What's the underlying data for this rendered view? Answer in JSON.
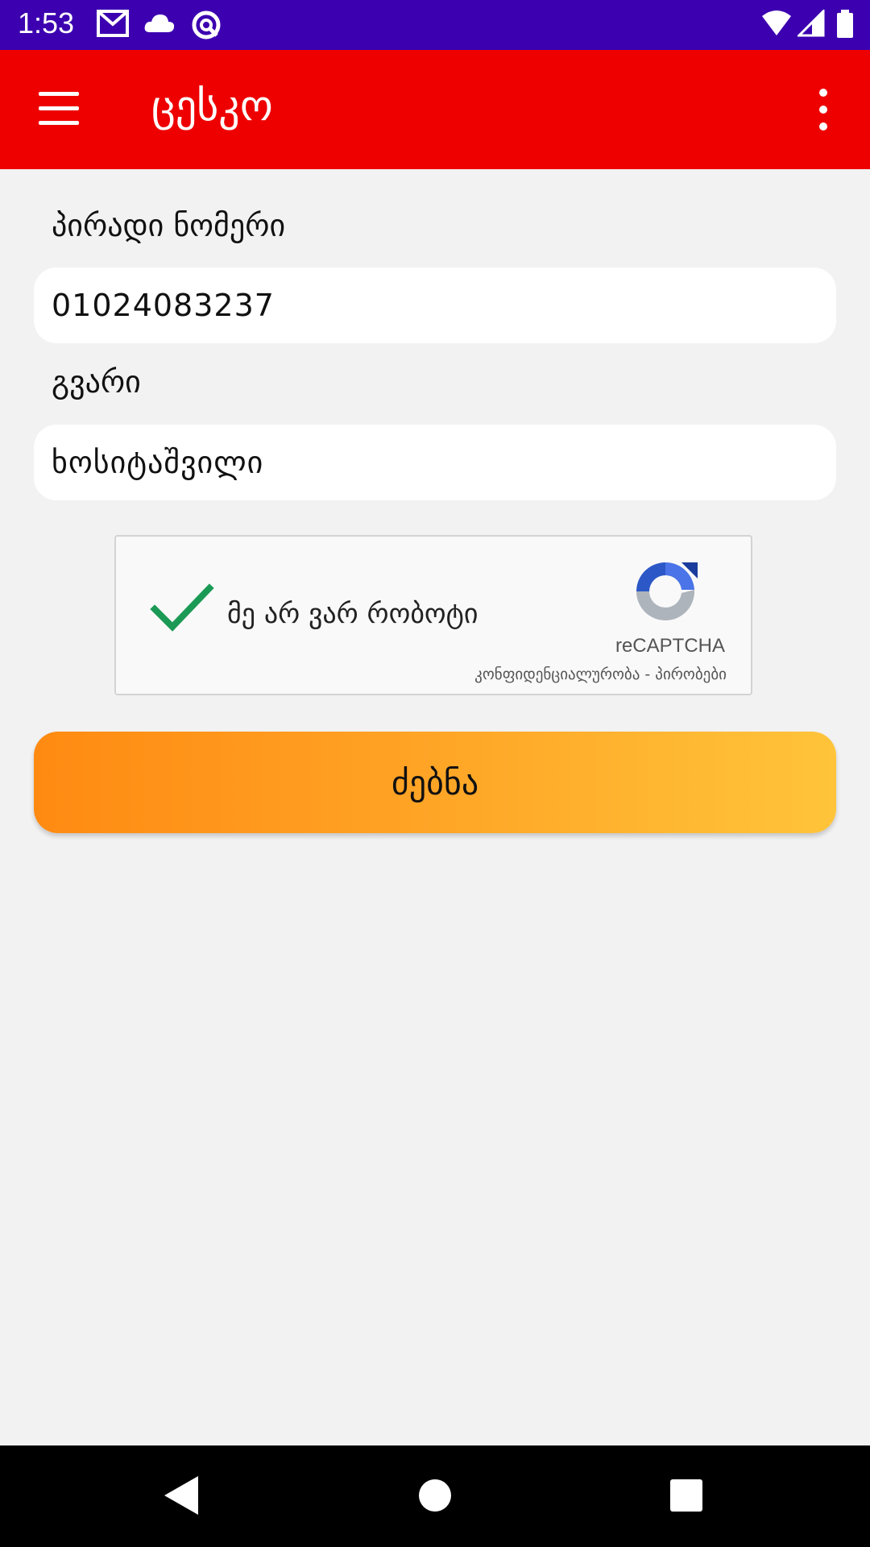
{
  "status_bar": {
    "time": "1:53",
    "icons": [
      "gmail-icon",
      "cloud-icon",
      "sync-icon",
      "wifi-icon",
      "signal-icon",
      "battery-icon"
    ]
  },
  "app_bar": {
    "title": "ცესკო",
    "menu_icon": "hamburger-menu-icon",
    "more_icon": "more-vert-icon",
    "background_color": "#ee0000"
  },
  "form": {
    "personal_number": {
      "label": "პირადი ნომერი",
      "value": "01024083237"
    },
    "surname": {
      "label": "გვარი",
      "value": "ხოსიტაშვილი"
    }
  },
  "captcha": {
    "label": "მე არ ვარ რობოტი",
    "checked": true,
    "brand": "reCAPTCHA",
    "legal": "კონფიდენციალურობა - პირობები"
  },
  "search_button": {
    "label": "ძებნა",
    "gradient": [
      "#ff8a12",
      "#ffc43a"
    ]
  },
  "nav_bar": {
    "icons": [
      "back-icon",
      "home-icon",
      "recents-icon"
    ]
  }
}
